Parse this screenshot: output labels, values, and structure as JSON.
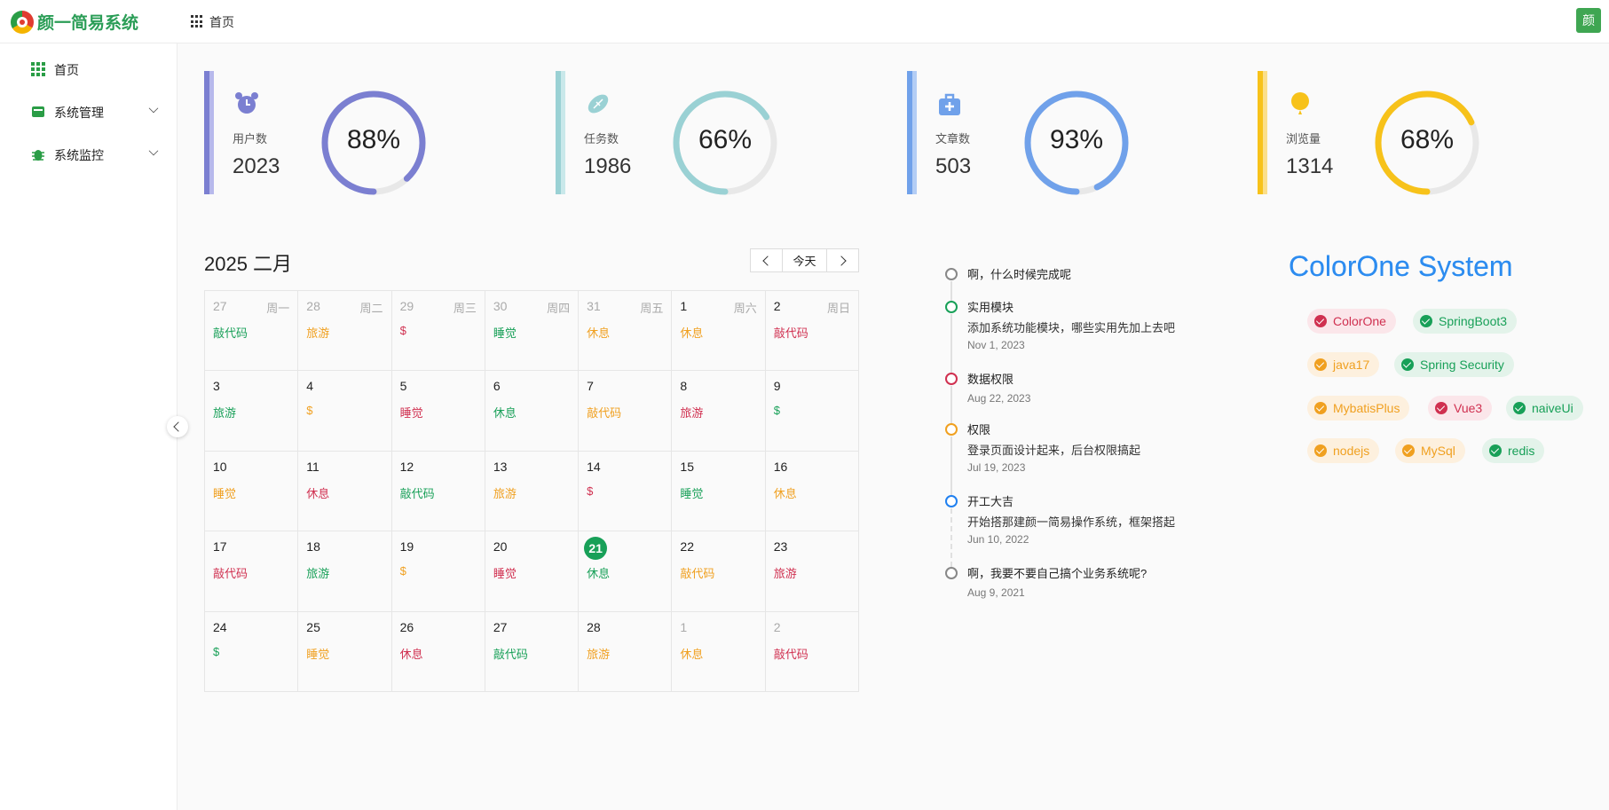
{
  "header": {
    "app_name": "颜一简易系统",
    "breadcrumb": "首页",
    "avatar_text": "颜"
  },
  "sidebar": {
    "items": [
      {
        "label": "首页",
        "icon": "grid-icon"
      },
      {
        "label": "系统管理",
        "icon": "inbox-icon"
      },
      {
        "label": "系统监控",
        "icon": "bug-icon"
      }
    ]
  },
  "stats": [
    {
      "label": "用户数",
      "value": "2023",
      "percent": "88%",
      "fraction": 0.88,
      "color": "#7b7fd1",
      "light": "#b7b9ec",
      "icon": "alarm-clock-icon"
    },
    {
      "label": "任务数",
      "value": "1986",
      "percent": "66%",
      "fraction": 0.66,
      "color": "#9ad1d4",
      "light": "#c9e8ea",
      "icon": "football-icon"
    },
    {
      "label": "文章数",
      "value": "503",
      "percent": "93%",
      "fraction": 0.93,
      "color": "#70a1ea",
      "light": "#b3cdf5",
      "icon": "briefcase-plus-icon"
    },
    {
      "label": "浏览量",
      "value": "1314",
      "percent": "68%",
      "fraction": 0.68,
      "color": "#f7c21a",
      "light": "#fbdf8a",
      "icon": "balloon-icon"
    }
  ],
  "calendar": {
    "title": "2025 二月",
    "today_label": "今天",
    "weekdays": [
      "周一",
      "周二",
      "周三",
      "周四",
      "周五",
      "周六",
      "周日"
    ],
    "cells": [
      {
        "d": "27",
        "ev": "敲代码",
        "c": "green",
        "other": true
      },
      {
        "d": "28",
        "ev": "旅游",
        "c": "orange",
        "other": true
      },
      {
        "d": "29",
        "ev": "$",
        "c": "red",
        "other": true
      },
      {
        "d": "30",
        "ev": "睡觉",
        "c": "green",
        "other": true
      },
      {
        "d": "31",
        "ev": "休息",
        "c": "orange",
        "other": true
      },
      {
        "d": "1",
        "ev": "休息",
        "c": "orange"
      },
      {
        "d": "2",
        "ev": "敲代码",
        "c": "red"
      },
      {
        "d": "3",
        "ev": "旅游",
        "c": "green"
      },
      {
        "d": "4",
        "ev": "$",
        "c": "orange"
      },
      {
        "d": "5",
        "ev": "睡觉",
        "c": "red"
      },
      {
        "d": "6",
        "ev": "休息",
        "c": "green"
      },
      {
        "d": "7",
        "ev": "敲代码",
        "c": "orange"
      },
      {
        "d": "8",
        "ev": "旅游",
        "c": "red"
      },
      {
        "d": "9",
        "ev": "$",
        "c": "green"
      },
      {
        "d": "10",
        "ev": "睡觉",
        "c": "orange"
      },
      {
        "d": "11",
        "ev": "休息",
        "c": "red"
      },
      {
        "d": "12",
        "ev": "敲代码",
        "c": "green"
      },
      {
        "d": "13",
        "ev": "旅游",
        "c": "orange"
      },
      {
        "d": "14",
        "ev": "$",
        "c": "red"
      },
      {
        "d": "15",
        "ev": "睡觉",
        "c": "green"
      },
      {
        "d": "16",
        "ev": "休息",
        "c": "orange"
      },
      {
        "d": "17",
        "ev": "敲代码",
        "c": "red"
      },
      {
        "d": "18",
        "ev": "旅游",
        "c": "green"
      },
      {
        "d": "19",
        "ev": "$",
        "c": "orange"
      },
      {
        "d": "20",
        "ev": "睡觉",
        "c": "red"
      },
      {
        "d": "21",
        "ev": "休息",
        "c": "green",
        "today": true
      },
      {
        "d": "22",
        "ev": "敲代码",
        "c": "orange"
      },
      {
        "d": "23",
        "ev": "旅游",
        "c": "red"
      },
      {
        "d": "24",
        "ev": "$",
        "c": "green"
      },
      {
        "d": "25",
        "ev": "睡觉",
        "c": "orange"
      },
      {
        "d": "26",
        "ev": "休息",
        "c": "red"
      },
      {
        "d": "27",
        "ev": "敲代码",
        "c": "green"
      },
      {
        "d": "28",
        "ev": "旅游",
        "c": "orange"
      },
      {
        "d": "1",
        "ev": "休息",
        "c": "orange",
        "other": true
      },
      {
        "d": "2",
        "ev": "敲代码",
        "c": "red",
        "other": true
      }
    ]
  },
  "timeline": [
    {
      "title": "啊，什么时候完成呢",
      "content": "",
      "time": "",
      "color": "#888888"
    },
    {
      "title": "实用模块",
      "content": "添加系统功能模块，哪些实用先加上去吧",
      "time": "Nov 1, 2023",
      "color": "#18a058"
    },
    {
      "title": "数据权限",
      "content": "",
      "time": "Aug 22, 2023",
      "color": "#d03050"
    },
    {
      "title": "权限",
      "content": "登录页面设计起来，后台权限搞起",
      "time": "Jul 19, 2023",
      "color": "#f0a020"
    },
    {
      "title": "开工大吉",
      "content": "开始搭那建颜一简易操作系统，框架搭起",
      "time": "Jun 10, 2022",
      "color": "#2080f0"
    },
    {
      "title": "啊，我要不要自己搞个业务系统呢?",
      "content": "",
      "time": "Aug 9, 2021",
      "color": "#888888"
    }
  ],
  "brand": "ColorOne System",
  "tags": [
    {
      "label": "ColorOne",
      "type": "red"
    },
    {
      "label": "SpringBoot3",
      "type": "green"
    },
    {
      "label": "java17",
      "type": "orange"
    },
    {
      "label": "Spring Security",
      "type": "green"
    },
    {
      "label": "MybatisPlus",
      "type": "orange"
    },
    {
      "label": "Vue3",
      "type": "red"
    },
    {
      "label": "naiveUi",
      "type": "green"
    },
    {
      "label": "nodejs",
      "type": "orange"
    },
    {
      "label": "MySql",
      "type": "orange"
    },
    {
      "label": "redis",
      "type": "green"
    }
  ]
}
